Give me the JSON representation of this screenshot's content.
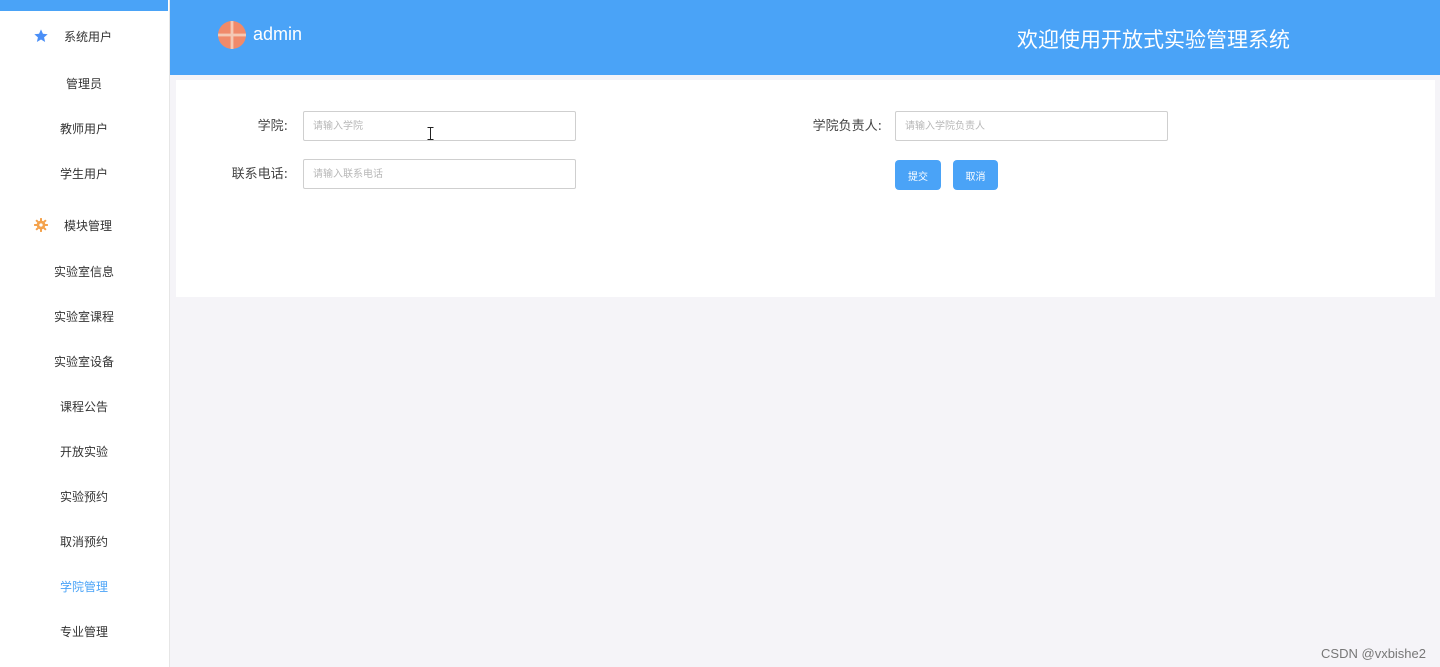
{
  "sidebar": {
    "groups": [
      {
        "label": "系统用户",
        "icon": "star-icon",
        "icon_color": "#4a8ff7"
      },
      {
        "label": "模块管理",
        "icon": "gear-icon",
        "icon_color": "#f4a24c"
      }
    ],
    "user_items": [
      {
        "label": "管理员"
      },
      {
        "label": "教师用户"
      },
      {
        "label": "学生用户"
      }
    ],
    "module_items": [
      {
        "label": "实验室信息"
      },
      {
        "label": "实验室课程"
      },
      {
        "label": "实验室设备"
      },
      {
        "label": "课程公告"
      },
      {
        "label": "开放实验"
      },
      {
        "label": "实验预约"
      },
      {
        "label": "取消预约"
      },
      {
        "label": "学院管理",
        "active": true
      },
      {
        "label": "专业管理"
      }
    ]
  },
  "header": {
    "username": "admin",
    "title": "欢迎使用开放式实验管理系统",
    "accent_color": "#4aa3f7"
  },
  "form": {
    "college_label": "学院:",
    "college_placeholder": "请输入学院",
    "college_value": "",
    "leader_label": "学院负责人:",
    "leader_placeholder": "请输入学院负责人",
    "leader_value": "",
    "phone_label": "联系电话:",
    "phone_placeholder": "请输入联系电话",
    "phone_value": "",
    "submit_label": "提交",
    "cancel_label": "取消"
  },
  "watermark": "CSDN @vxbishe2"
}
